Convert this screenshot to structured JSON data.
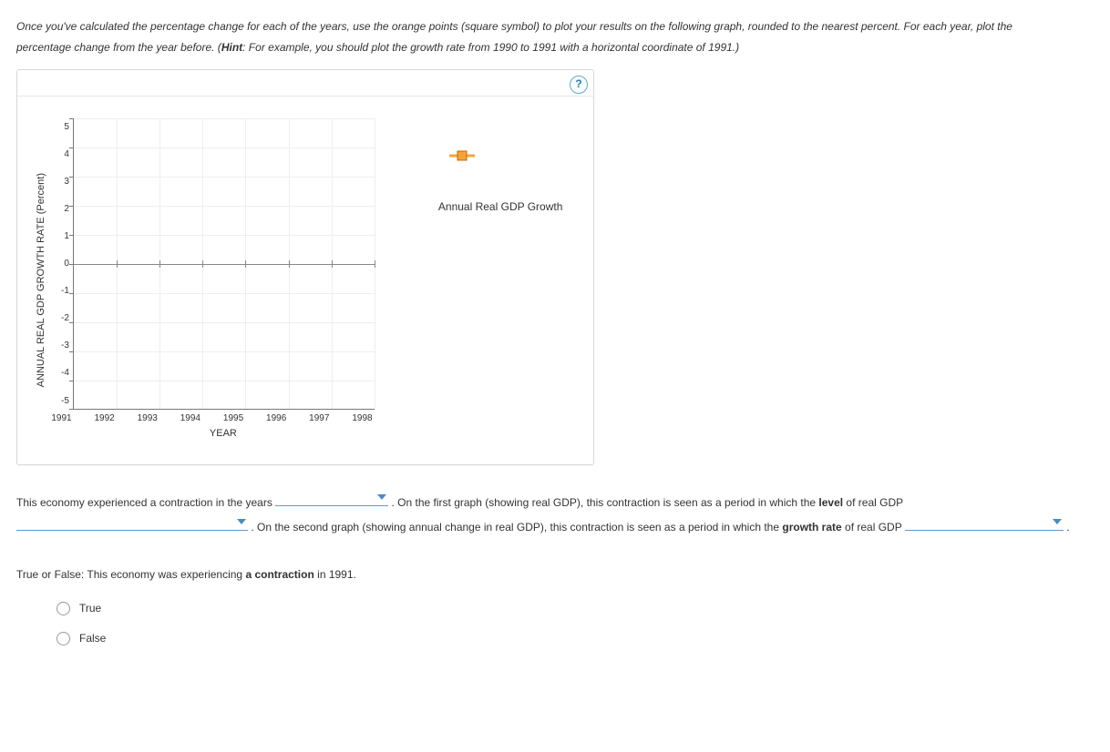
{
  "instructions": {
    "line": "Once you've calculated the percentage change for each of the years, use the orange points (square symbol) to plot your results on the following graph, rounded to the nearest percent. For each year, plot the percentage change from the year before. (",
    "hint_label": "Hint",
    "hint_tail": ": For example, you should plot the growth rate from 1990 to 1991 with a horizontal coordinate of 1991.)"
  },
  "help_label": "?",
  "chart_data": {
    "type": "line",
    "title": "",
    "xlabel": "YEAR",
    "ylabel": "ANNUAL REAL GDP GROWTH RATE (Percent)",
    "x_ticks": [
      "1991",
      "1992",
      "1993",
      "1994",
      "1995",
      "1996",
      "1997",
      "1998"
    ],
    "y_ticks": [
      "5",
      "4",
      "3",
      "2",
      "1",
      "0",
      "-1",
      "-2",
      "-3",
      "-4",
      "-5"
    ],
    "ylim": [
      -5,
      5
    ],
    "xlim": [
      1991,
      1998
    ],
    "series": [
      {
        "name": "Annual Real GDP Growth",
        "values": []
      }
    ],
    "legend": {
      "label": "Annual Real GDP Growth"
    }
  },
  "paragraph": {
    "t1": "This economy experienced a contraction in the years ",
    "t2": " . On the first graph (showing real GDP), this contraction is seen as a period in which the ",
    "level_word": "level",
    "t3": " of real GDP ",
    "t4": " . On the second graph (showing annual change in real GDP), this contraction is seen as a period in which the ",
    "growth_word": "growth rate",
    "t5": " of real GDP ",
    "t6": " ."
  },
  "tf": {
    "prompt_a": "True or False: This economy was experiencing ",
    "prompt_bold": "a contraction",
    "prompt_b": " in 1991.",
    "opt_true": "True",
    "opt_false": "False"
  }
}
